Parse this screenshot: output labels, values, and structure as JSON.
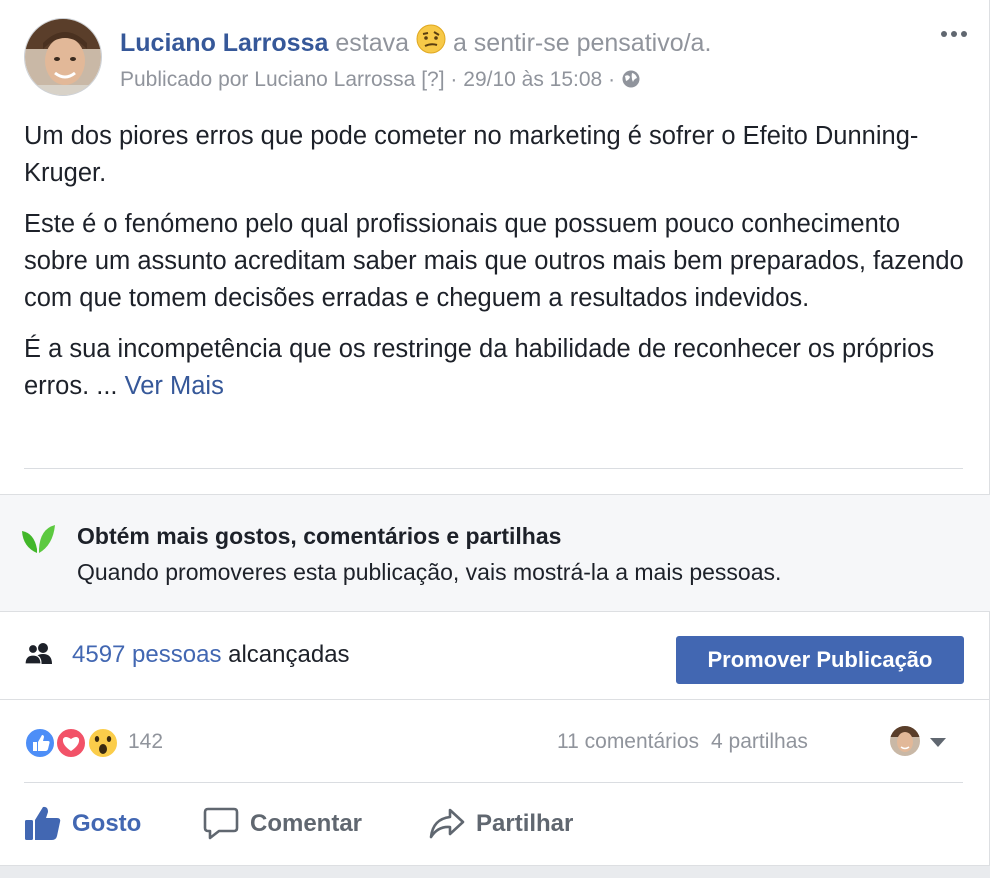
{
  "post": {
    "author": "Luciano Larrossa",
    "verb": "estava",
    "feeling": "a sentir-se pensativo/a.",
    "published_prefix": "Publicado por",
    "published_by": "Luciano Larrossa",
    "help_marker": "[?]",
    "dot": "·",
    "date": "29/10 às 15:08",
    "paragraphs": [
      "Um dos piores erros que pode cometer no marketing é sofrer o Efeito Dunning-Kruger.",
      "Este é o fenómeno pelo qual profissionais que possuem pouco conhecimento sobre um assunto acreditam saber mais que outros mais bem preparados, fazendo com que tomem decisões erradas e cheguem a resultados indevidos.",
      "É a sua incompetência que os restringe da habilidade de reconhecer os próprios erros. ..."
    ],
    "see_more": "Ver Mais"
  },
  "promo": {
    "title": "Obtém mais gostos, comentários e partilhas",
    "description": "Quando promoveres esta publicação, vais mostrá-la a mais pessoas."
  },
  "reach": {
    "count": "4597 pessoas",
    "suffix": " alcançadas",
    "promote_button": "Promover Publicação"
  },
  "reactions": {
    "count": "142",
    "comments": "11 comentários",
    "shares": "4 partilhas"
  },
  "actions": {
    "like": "Gosto",
    "comment": "Comentar",
    "share": "Partilhar"
  },
  "colors": {
    "link_blue": "#365899",
    "brand_blue": "#4267b2",
    "meta_gray": "#90949c",
    "promo_bg": "#f6f7f9",
    "leaf_green": "#42b72a"
  },
  "icons": [
    "feeling-pensive-icon",
    "globe-icon",
    "more-options-icon",
    "leaf-icon",
    "people-icon",
    "like-reaction-icon",
    "love-reaction-icon",
    "wow-reaction-icon",
    "thumbs-up-icon",
    "comment-icon",
    "share-icon",
    "caret-down-icon"
  ]
}
